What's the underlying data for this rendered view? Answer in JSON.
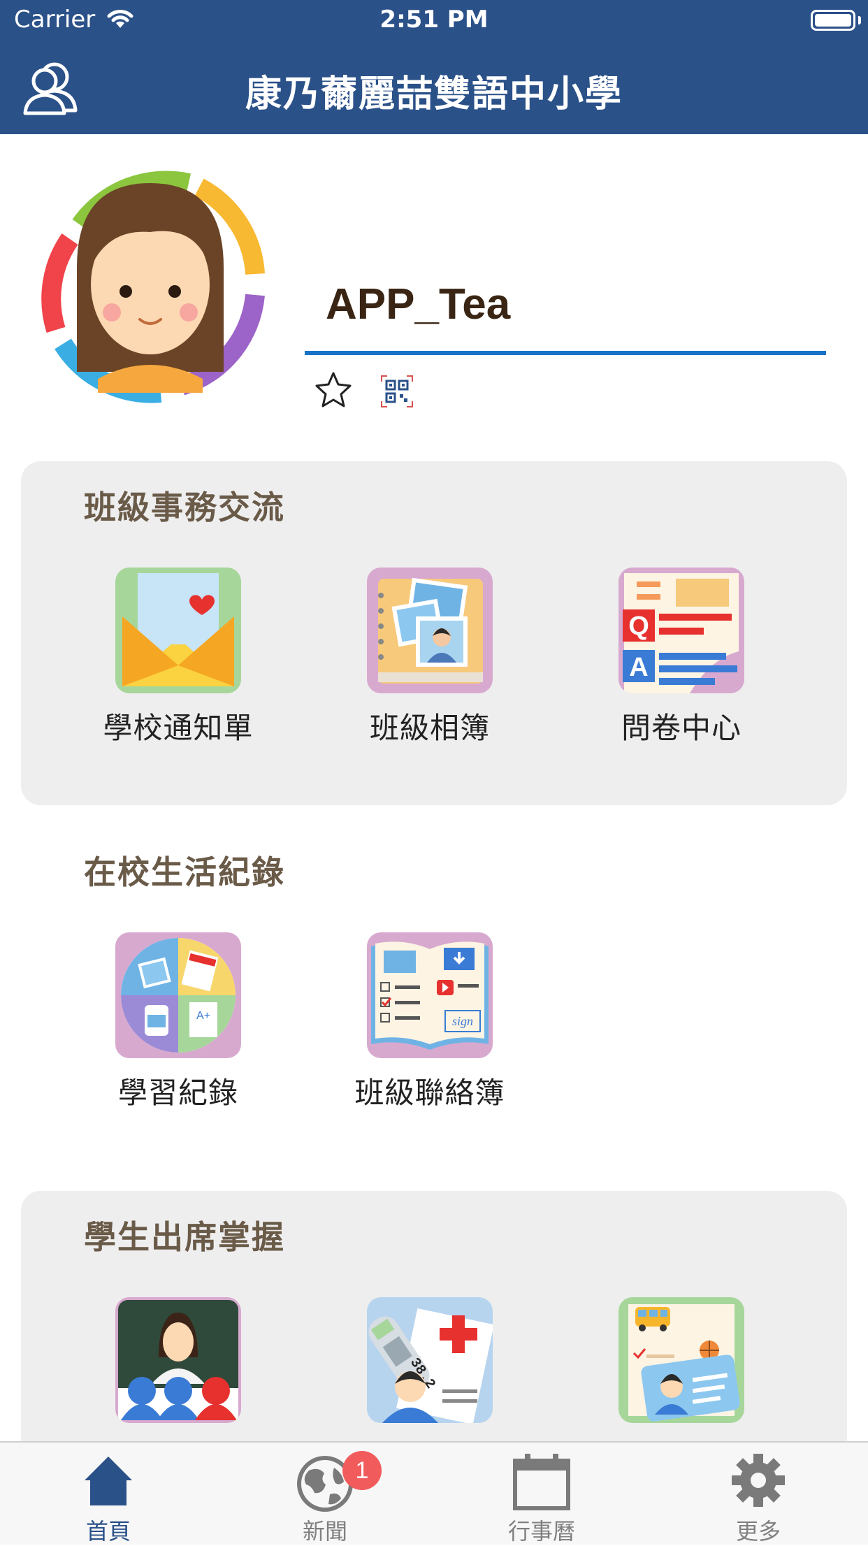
{
  "status_bar": {
    "carrier": "Carrier",
    "time": "2:51 PM"
  },
  "nav": {
    "title": "康乃薾麗喆雙語中小學"
  },
  "profile": {
    "username": "APP_Tea"
  },
  "sections": [
    {
      "title": "班級事務交流",
      "items": [
        {
          "label": "學校通知單",
          "icon": "notice-envelope-icon"
        },
        {
          "label": "班級相簿",
          "icon": "class-album-icon"
        },
        {
          "label": "問卷中心",
          "icon": "survey-qa-icon"
        }
      ]
    },
    {
      "title": "在校生活紀錄",
      "items": [
        {
          "label": "學習紀錄",
          "icon": "learning-record-icon"
        },
        {
          "label": "班級聯絡簿",
          "icon": "contact-book-icon"
        }
      ]
    },
    {
      "title": "學生出席掌握",
      "items": [
        {
          "label": "",
          "icon": "teacher-class-icon"
        },
        {
          "label": "",
          "icon": "health-thermometer-icon"
        },
        {
          "label": "",
          "icon": "student-id-card-icon"
        }
      ]
    }
  ],
  "tabbar": {
    "items": [
      {
        "label": "首頁",
        "icon": "home-icon",
        "active": true
      },
      {
        "label": "新聞",
        "icon": "globe-icon",
        "badge": "1"
      },
      {
        "label": "行事曆",
        "icon": "calendar-icon"
      },
      {
        "label": "更多",
        "icon": "gear-icon"
      }
    ]
  },
  "colors": {
    "primary": "#2b5189",
    "accent_line": "#1a73c8",
    "badge": "#f15b5b",
    "panel": "#eeeeee"
  }
}
